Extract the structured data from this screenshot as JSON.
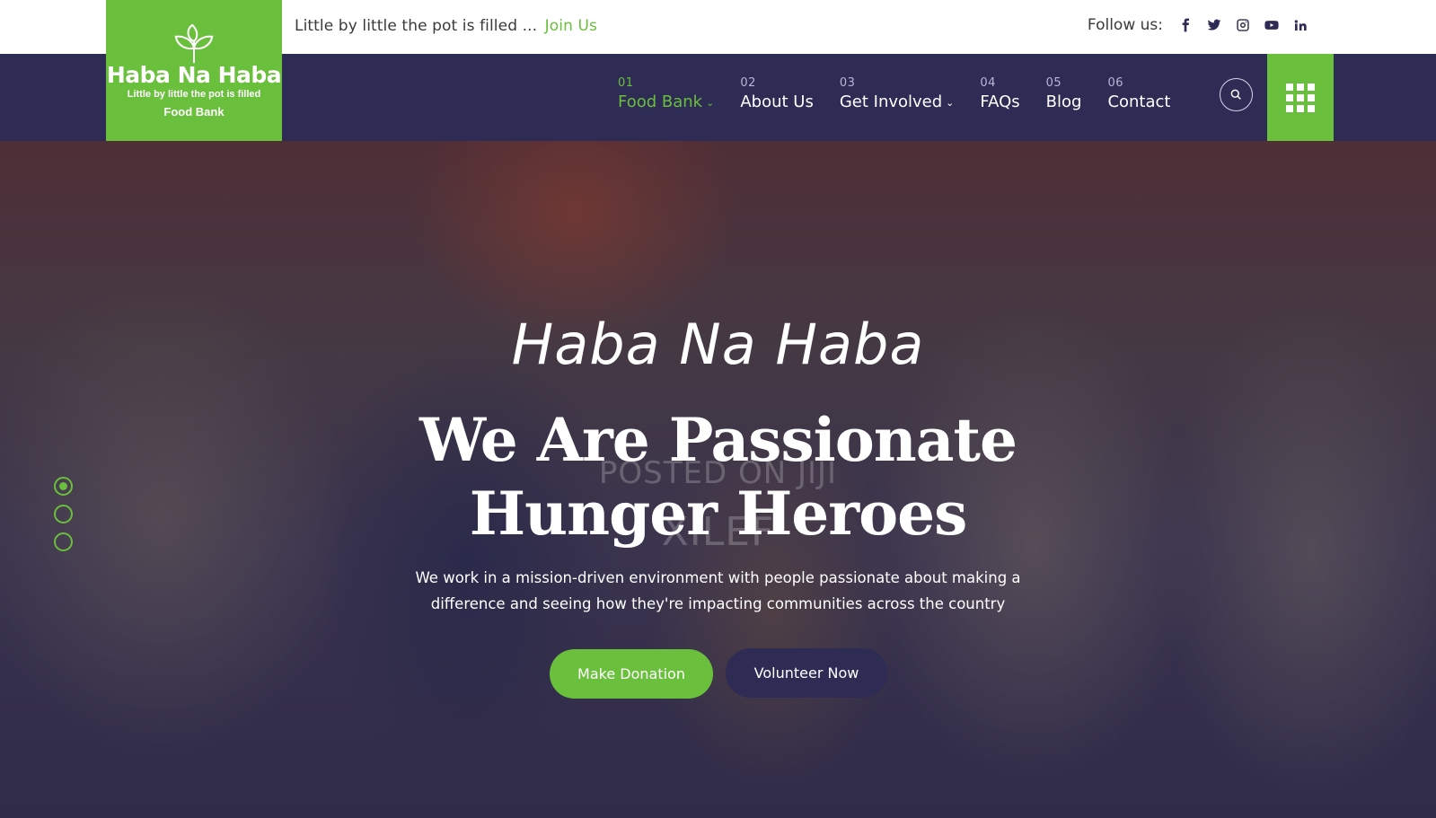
{
  "topbar": {
    "tagline": "Little by little the pot is filled ...",
    "join_label": "Join Us",
    "follow_label": "Follow us:",
    "social": [
      "facebook-icon",
      "twitter-icon",
      "instagram-icon",
      "youtube-icon",
      "linkedin-icon"
    ]
  },
  "logo": {
    "title": "Haba Na Haba",
    "subtitle": "Little by little the pot is filled",
    "sub2": "Food Bank"
  },
  "nav": {
    "items": [
      {
        "num": "01",
        "label": "Food Bank",
        "dropdown": true,
        "active": true
      },
      {
        "num": "02",
        "label": "About Us",
        "dropdown": false
      },
      {
        "num": "03",
        "label": "Get Involved",
        "dropdown": true
      },
      {
        "num": "04",
        "label": "FAQs",
        "dropdown": false
      },
      {
        "num": "05",
        "label": "Blog",
        "dropdown": false
      },
      {
        "num": "06",
        "label": "Contact",
        "dropdown": false
      }
    ]
  },
  "hero": {
    "script_title": "Haba Na Haba",
    "headline_line1": "We Are Passionate",
    "headline_line2": "Hunger Heroes",
    "watermark1": "POSTED ON JIJI",
    "watermark2": "XILEF",
    "desc_line1": "We work in a mission-driven environment with people passionate about making a",
    "desc_line2": "difference and seeing how they're impacting communities across the country",
    "donate_label": "Make Donation",
    "volunteer_label": "Volunteer Now",
    "slides": 3,
    "active_slide": 1
  },
  "colors": {
    "brand_green": "#6abf3c",
    "brand_navy": "#2e2b55"
  }
}
